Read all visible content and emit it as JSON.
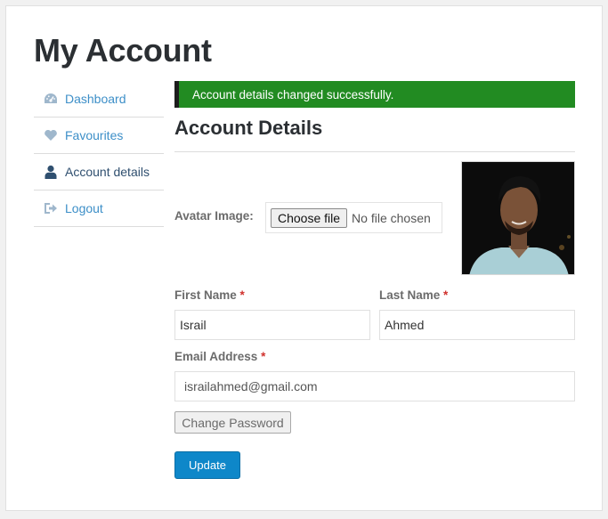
{
  "page": {
    "title": "My Account"
  },
  "sidebar": {
    "items": [
      {
        "label": "Dashboard",
        "icon": "dashboard-icon"
      },
      {
        "label": "Favourites",
        "icon": "heart-icon"
      },
      {
        "label": "Account details",
        "icon": "user-icon"
      },
      {
        "label": "Logout",
        "icon": "logout-icon"
      }
    ],
    "active": "Account details"
  },
  "notice": {
    "text": "Account details changed successfully."
  },
  "section": {
    "title": "Account Details"
  },
  "avatar": {
    "label": "Avatar Image:",
    "button": "Choose file",
    "status": "No file chosen"
  },
  "form": {
    "first_name": {
      "label": "First Name",
      "required": "*",
      "value": "Israil"
    },
    "last_name": {
      "label": "Last Name",
      "required": "*",
      "value": "Ahmed"
    },
    "email": {
      "label": "Email Address",
      "required": "*",
      "value": "israilahmed@gmail.com"
    },
    "change_password_label": "Change Password",
    "update_label": "Update"
  },
  "colors": {
    "link": "#3d8fc8",
    "notice_bg": "#228b22",
    "primary_button": "#0e87c9",
    "required": "#d0312d"
  }
}
